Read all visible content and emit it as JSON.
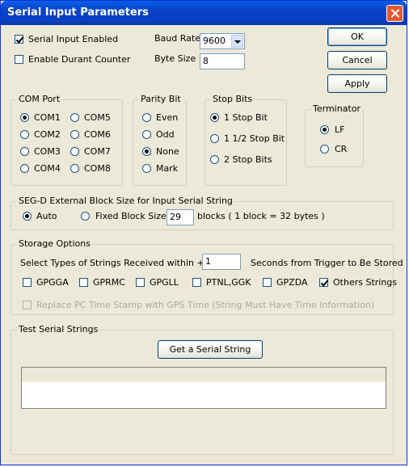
{
  "window": {
    "title": "Serial Input Parameters"
  },
  "top": {
    "serial_input_enabled": {
      "label": "Serial Input Enabled",
      "checked": true
    },
    "enable_durant_counter": {
      "label": "Enable Durant Counter",
      "checked": false
    },
    "baud_rate_label": "Baud Rate",
    "baud_rate_value": "9600",
    "byte_size_label": "Byte Size",
    "byte_size_value": "8"
  },
  "buttons": {
    "ok": "OK",
    "cancel": "Cancel",
    "apply": "Apply"
  },
  "com_port": {
    "title": "COM Port",
    "options": [
      "COM1",
      "COM5",
      "COM2",
      "COM6",
      "COM3",
      "COM7",
      "COM4",
      "COM8"
    ],
    "selected": "COM1"
  },
  "parity_bit": {
    "title": "Parity Bit",
    "options": [
      "Even",
      "Odd",
      "None",
      "Mark"
    ],
    "selected": "None"
  },
  "stop_bits": {
    "title": "Stop Bits",
    "options": [
      "1 Stop Bit",
      "1 1/2 Stop Bit",
      "2 Stop Bits"
    ],
    "selected": "1 Stop Bit"
  },
  "terminator": {
    "title": "Terminator",
    "options": [
      "LF",
      "CR"
    ],
    "selected": "LF"
  },
  "segd": {
    "title": "SEG-D External Block Size for Input Serial String",
    "auto_label": "Auto",
    "fixed_label": "Fixed Block Size:",
    "selected": "Auto",
    "block_size_value": "29",
    "blocks_note": "blocks ( 1 block = 32 bytes )"
  },
  "storage": {
    "title": "Storage Options",
    "select_label": "Select Types of Strings Received within +/-",
    "seconds_value": "1",
    "seconds_label": "Seconds from Trigger to Be Stored",
    "types": [
      {
        "label": "GPGGA",
        "checked": false
      },
      {
        "label": "GPRMC",
        "checked": false
      },
      {
        "label": "GPGLL",
        "checked": false
      },
      {
        "label": "PTNL,GGK",
        "checked": false
      },
      {
        "label": "GPZDA",
        "checked": false
      },
      {
        "label": "Others Strings",
        "checked": true
      }
    ],
    "replace_label": "Replace PC Time Stamp with GPS Time (String Must Have Time Information)"
  },
  "test": {
    "title": "Test Serial Strings",
    "get_button": "Get a Serial String"
  }
}
